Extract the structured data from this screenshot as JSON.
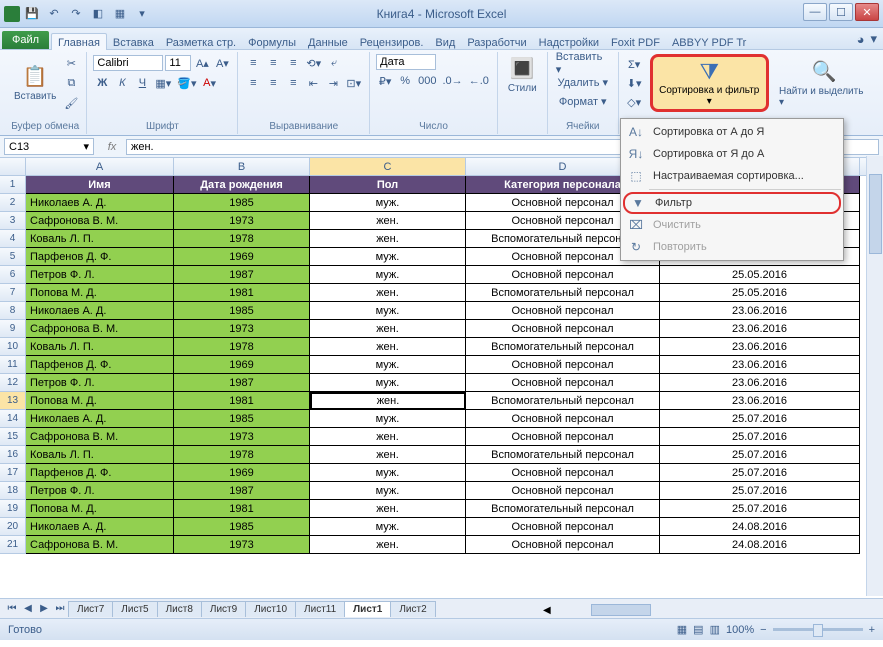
{
  "title": "Книга4 - Microsoft Excel",
  "qat": [
    "save",
    "undo",
    "redo",
    "◧",
    "▦",
    "☰"
  ],
  "tabs": {
    "file": "Файл",
    "items": [
      "Главная",
      "Вставка",
      "Разметка стр.",
      "Формулы",
      "Данные",
      "Рецензиров.",
      "Вид",
      "Разработчи",
      "Надстройки",
      "Foxit PDF",
      "ABBYY PDF Tr"
    ],
    "active": 0
  },
  "ribbon": {
    "clipboard": {
      "paste": "Вставить",
      "label": "Буфер обмена"
    },
    "font": {
      "name": "Calibri",
      "size": "11",
      "label": "Шрифт"
    },
    "align": {
      "label": "Выравнивание"
    },
    "number": {
      "fmt": "Дата",
      "label": "Число"
    },
    "styles": {
      "btn": "Стили"
    },
    "cells": {
      "insert": "Вставить ▾",
      "delete": "Удалить ▾",
      "format": "Формат ▾",
      "label": "Ячейки"
    },
    "editing": {
      "sort": "Сортировка и фильтр ▾",
      "find": "Найти и выделить ▾"
    }
  },
  "dropdown": {
    "sort_az": "Сортировка от А до Я",
    "sort_za": "Сортировка от Я до А",
    "custom": "Настраиваемая сортировка...",
    "filter": "Фильтр",
    "clear": "Очистить",
    "reapply": "Повторить"
  },
  "namebox": "C13",
  "formula": "жен.",
  "cols": [
    "A",
    "B",
    "C",
    "D",
    "E"
  ],
  "headers": {
    "a": "Имя",
    "b": "Дата рождения",
    "c": "Пол",
    "d": "Категория персонала",
    "e": ""
  },
  "rows": [
    {
      "n": 2,
      "a": "Николаев А. Д.",
      "b": "1985",
      "c": "муж.",
      "d": "Основной персонал",
      "e": ""
    },
    {
      "n": 3,
      "a": "Сафронова В. М.",
      "b": "1973",
      "c": "жен.",
      "d": "Основной персонал",
      "e": ""
    },
    {
      "n": 4,
      "a": "Коваль Л. П.",
      "b": "1978",
      "c": "жен.",
      "d": "Вспомогательный персонал",
      "e": ""
    },
    {
      "n": 5,
      "a": "Парфенов Д. Ф.",
      "b": "1969",
      "c": "муж.",
      "d": "Основной персонал",
      "e": "25.05.2016"
    },
    {
      "n": 6,
      "a": "Петров Ф. Л.",
      "b": "1987",
      "c": "муж.",
      "d": "Основной персонал",
      "e": "25.05.2016"
    },
    {
      "n": 7,
      "a": "Попова М. Д.",
      "b": "1981",
      "c": "жен.",
      "d": "Вспомогательный персонал",
      "e": "25.05.2016"
    },
    {
      "n": 8,
      "a": "Николаев А. Д.",
      "b": "1985",
      "c": "муж.",
      "d": "Основной персонал",
      "e": "23.06.2016"
    },
    {
      "n": 9,
      "a": "Сафронова В. М.",
      "b": "1973",
      "c": "жен.",
      "d": "Основной персонал",
      "e": "23.06.2016"
    },
    {
      "n": 10,
      "a": "Коваль Л. П.",
      "b": "1978",
      "c": "жен.",
      "d": "Вспомогательный персонал",
      "e": "23.06.2016"
    },
    {
      "n": 11,
      "a": "Парфенов Д. Ф.",
      "b": "1969",
      "c": "муж.",
      "d": "Основной персонал",
      "e": "23.06.2016"
    },
    {
      "n": 12,
      "a": "Петров Ф. Л.",
      "b": "1987",
      "c": "муж.",
      "d": "Основной персонал",
      "e": "23.06.2016"
    },
    {
      "n": 13,
      "a": "Попова М. Д.",
      "b": "1981",
      "c": "жен.",
      "d": "Вспомогательный персонал",
      "e": "23.06.2016",
      "sel": true
    },
    {
      "n": 14,
      "a": "Николаев А. Д.",
      "b": "1985",
      "c": "муж.",
      "d": "Основной персонал",
      "e": "25.07.2016"
    },
    {
      "n": 15,
      "a": "Сафронова В. М.",
      "b": "1973",
      "c": "жен.",
      "d": "Основной персонал",
      "e": "25.07.2016"
    },
    {
      "n": 16,
      "a": "Коваль Л. П.",
      "b": "1978",
      "c": "жен.",
      "d": "Вспомогательный персонал",
      "e": "25.07.2016"
    },
    {
      "n": 17,
      "a": "Парфенов Д. Ф.",
      "b": "1969",
      "c": "муж.",
      "d": "Основной персонал",
      "e": "25.07.2016"
    },
    {
      "n": 18,
      "a": "Петров Ф. Л.",
      "b": "1987",
      "c": "муж.",
      "d": "Основной персонал",
      "e": "25.07.2016"
    },
    {
      "n": 19,
      "a": "Попова М. Д.",
      "b": "1981",
      "c": "жен.",
      "d": "Вспомогательный персонал",
      "e": "25.07.2016"
    },
    {
      "n": 20,
      "a": "Николаев А. Д.",
      "b": "1985",
      "c": "муж.",
      "d": "Основной персонал",
      "e": "24.08.2016"
    },
    {
      "n": 21,
      "a": "Сафронова В. М.",
      "b": "1973",
      "c": "жен.",
      "d": "Основной персонал",
      "e": "24.08.2016"
    }
  ],
  "sheets": {
    "items": [
      "Лист7",
      "Лист5",
      "Лист8",
      "Лист9",
      "Лист10",
      "Лист11",
      "Лист1",
      "Лист2"
    ],
    "active": 6
  },
  "status": {
    "ready": "Готово",
    "zoom": "100%"
  }
}
